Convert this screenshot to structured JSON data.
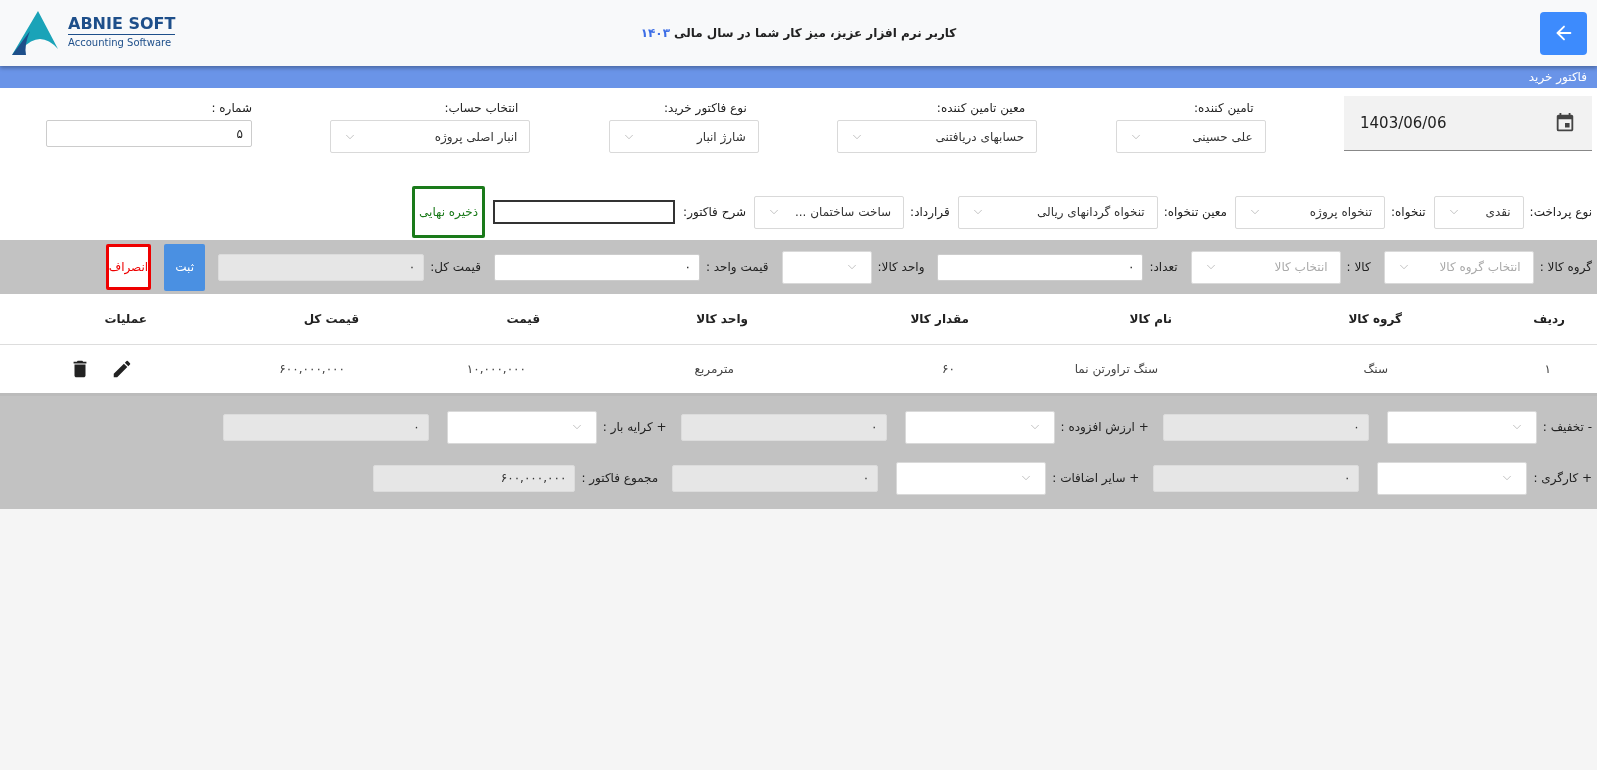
{
  "header": {
    "greeting": "کاربر نرم افزار عزیز، میز کار شما در سال مالی",
    "year": "۱۴۰۳",
    "logo_title": "ABNIE SOFT",
    "logo_subtitle": "Accounting Software"
  },
  "page_title": "فاکتور خرید",
  "form": {
    "date": "1403/06/06",
    "row_1": [
      {
        "label": "تامین کننده:",
        "value": "علی حسینی"
      },
      {
        "label": "معین تامین کننده:",
        "value": "حسابهای دریافتنی"
      },
      {
        "label": "نوع فاکتور خرید:",
        "value": "شارژ انبار"
      },
      {
        "label": "انتخاب حساب:",
        "value": "انبار اصلی پروژه"
      }
    ],
    "number": {
      "label": "شماره :",
      "value": "۵"
    },
    "row_2": [
      {
        "label": "نوع پرداخت:",
        "value": "نقدی"
      },
      {
        "label": "تنخواه:",
        "value": "تنخواه پروژه"
      },
      {
        "label": "معین تنخواه:",
        "value": "تنخواه گردانهای ریالی"
      },
      {
        "label": "قرارداد:",
        "value": "ساخت ساختمان ..."
      }
    ],
    "description": {
      "label": "شرح فاکتور:"
    },
    "final_save": "ذخیره نهایی"
  },
  "item_entry": {
    "fields": [
      {
        "kind": "select",
        "label": "گروه کالا :",
        "placeholder": "انتخاب گروه کالا"
      },
      {
        "kind": "select",
        "label": "کالا :",
        "placeholder": "انتخاب کالا"
      },
      {
        "kind": "input",
        "label": "تعداد:",
        "value": "۰",
        "disabled": false
      },
      {
        "kind": "select",
        "label": "واحد کالا:"
      },
      {
        "kind": "input",
        "label": "قیمت واحد :",
        "value": "۰",
        "disabled": false
      },
      {
        "kind": "input",
        "label": "قیمت کل:",
        "value": "۰",
        "disabled": true
      }
    ],
    "submit": "ثبت",
    "cancel": "انصراف"
  },
  "table": {
    "columns": [
      "ردیف",
      "گروه کالا",
      "نام کالا",
      "مقدار کالا",
      "واحد کالا",
      "قیمت",
      "قیمت کل",
      "عملیات"
    ],
    "rows": [
      [
        "۱",
        "سنگ",
        "سنگ تراورتن نما",
        "۶۰",
        "مترمربع",
        "۱۰,۰۰۰,۰۰۰",
        "۶۰۰,۰۰۰,۰۰۰"
      ]
    ]
  },
  "totals": [
    [
      {
        "kind": "select",
        "label": "- تخفیف :",
        "value": "۰",
        "disabled": true
      },
      {
        "kind": "select",
        "label": "+ ارزش افزوده :",
        "value": "۰",
        "disabled": true
      },
      {
        "kind": "select",
        "label": "+ کرایه بار :",
        "value": "۰",
        "disabled": true
      }
    ],
    [
      {
        "kind": "select",
        "label": "+ کارگری :",
        "value": "۰",
        "disabled": true
      },
      {
        "kind": "select",
        "label": "+ سایر اضافات :",
        "value": "۰",
        "disabled": true
      },
      {
        "kind": "field",
        "label": "مجموع فاکتور :",
        "value": "۶۰۰,۰۰۰,۰۰۰",
        "disabled": true
      }
    ]
  ]
}
